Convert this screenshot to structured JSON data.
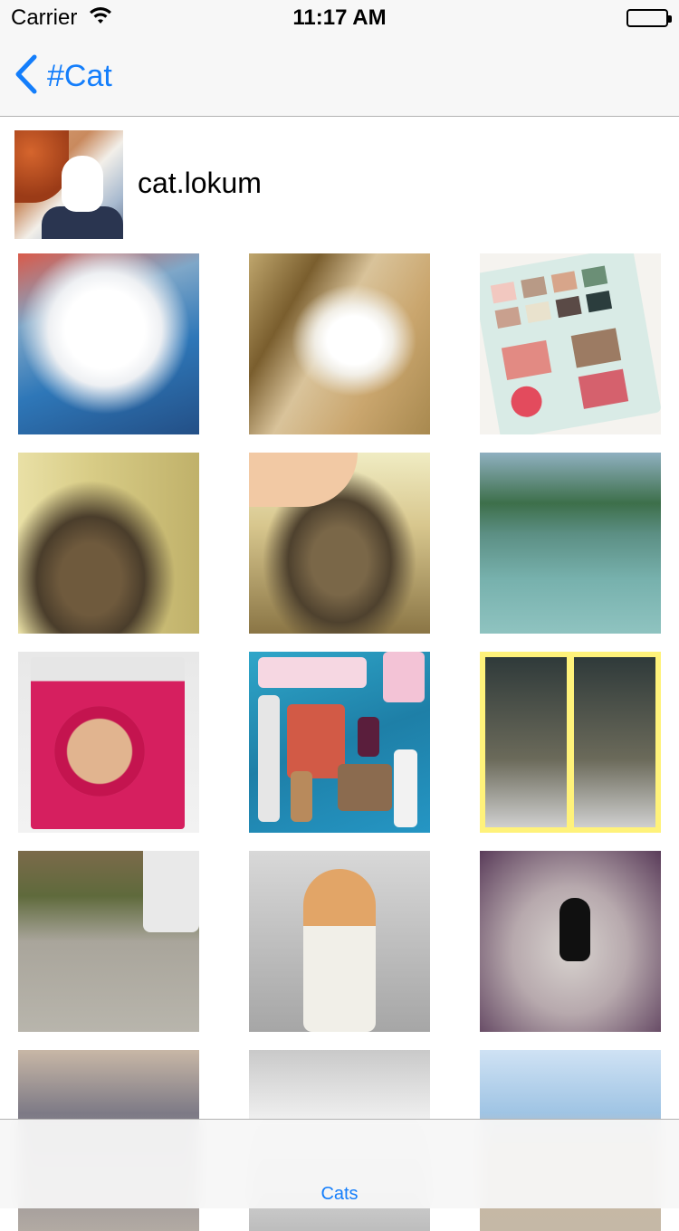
{
  "status_bar": {
    "carrier": "Carrier",
    "time": "11:17 AM",
    "wifi_icon": "wifi-icon",
    "battery_icon": "battery-icon"
  },
  "nav": {
    "back_label": "#Cat",
    "back_icon": "chevron-left-icon",
    "accent_color": "#147efb"
  },
  "profile": {
    "username": "cat.lokum",
    "avatar": "profile-photo"
  },
  "grid": {
    "items": [
      {
        "name": "white cat on blue blanket"
      },
      {
        "name": "white cat on rug"
      },
      {
        "name": "eyeshadow palette"
      },
      {
        "name": "tabby cat"
      },
      {
        "name": "hand petting tabby cat"
      },
      {
        "name": "kayak on river"
      },
      {
        "name": "bronzer box"
      },
      {
        "name": "cosmetics on blue"
      },
      {
        "name": "calico cat collage"
      },
      {
        "name": "white cat in parking lot"
      },
      {
        "name": "orange and white cat"
      },
      {
        "name": "black kitten"
      },
      {
        "name": "black cat on street"
      },
      {
        "name": "cat blur"
      },
      {
        "name": "rooftop view"
      }
    ]
  },
  "tab_bar": {
    "tabs": [
      {
        "label": "Cats",
        "selected": true
      }
    ]
  }
}
